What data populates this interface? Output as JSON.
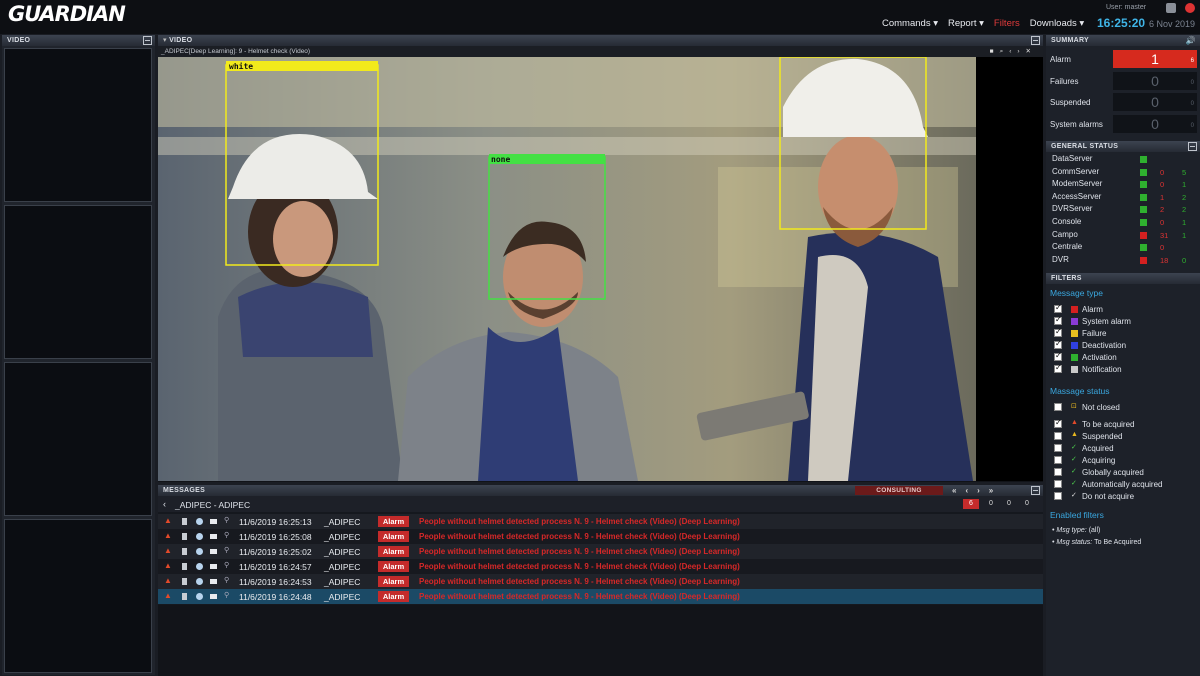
{
  "app": {
    "logo": "GUARDIAN",
    "user": "User: master",
    "clock": "16:25:20",
    "date": "6 Nov 2019"
  },
  "nav": [
    "Commands ▾",
    "Report ▾",
    "Filters",
    "Downloads ▾"
  ],
  "left_panel": {
    "title": "VIDEO"
  },
  "video_panel": {
    "title": "VIDEO",
    "caption": "_ADIPEC[Deep Learning]: 9 - Helmet check (Video)",
    "detections": [
      {
        "label": "white",
        "color": "#f2ea1c"
      },
      {
        "label": "none",
        "color": "#44e044"
      },
      {
        "label": "",
        "color": "#f2ea1c"
      }
    ]
  },
  "messages": {
    "title": "MESSAGES",
    "mode": "CONSULTING",
    "group": "_ADIPEC - ADIPEC",
    "counters": [
      "6",
      "0",
      "0",
      "0"
    ],
    "rows": [
      {
        "time": "11/6/2019 16:25:13",
        "source": "_ADIPEC",
        "type": "Alarm",
        "text": "People without helmet detected process N. 9 - Helmet check (Video) (Deep Learning)"
      },
      {
        "time": "11/6/2019 16:25:08",
        "source": "_ADIPEC",
        "type": "Alarm",
        "text": "People without helmet detected process N. 9 - Helmet check (Video) (Deep Learning)"
      },
      {
        "time": "11/6/2019 16:25:02",
        "source": "_ADIPEC",
        "type": "Alarm",
        "text": "People without helmet detected process N. 9 - Helmet check (Video) (Deep Learning)"
      },
      {
        "time": "11/6/2019 16:24:57",
        "source": "_ADIPEC",
        "type": "Alarm",
        "text": "People without helmet detected process N. 9 - Helmet check (Video) (Deep Learning)"
      },
      {
        "time": "11/6/2019 16:24:53",
        "source": "_ADIPEC",
        "type": "Alarm",
        "text": "People without helmet detected process N. 9 - Helmet check (Video) (Deep Learning)"
      },
      {
        "time": "11/6/2019 16:24:48",
        "source": "_ADIPEC",
        "type": "Alarm",
        "text": "People without helmet detected process N. 9 - Helmet check (Video) (Deep Learning)"
      }
    ]
  },
  "summary": {
    "title": "SUMMARY",
    "rows": [
      {
        "label": "Alarm",
        "value": "1",
        "small": "6",
        "highlight": true
      },
      {
        "label": "Failures",
        "value": "0",
        "small": "0",
        "highlight": false
      },
      {
        "label": "Suspended",
        "value": "0",
        "small": "0",
        "highlight": false
      },
      {
        "label": "System alarms",
        "value": "0",
        "small": "0",
        "highlight": false
      }
    ]
  },
  "general_status": {
    "title": "GENERAL STATUS",
    "rows": [
      {
        "name": "DataServer",
        "color": "#2fb02f",
        "a": "",
        "b": ""
      },
      {
        "name": "CommServer",
        "color": "#2fb02f",
        "a": "0",
        "b": "5"
      },
      {
        "name": "ModemServer",
        "color": "#2fb02f",
        "a": "0",
        "b": "1"
      },
      {
        "name": "AccessServer",
        "color": "#2fb02f",
        "a": "1",
        "b": "2"
      },
      {
        "name": "DVRServer",
        "color": "#2fb02f",
        "a": "2",
        "b": "2"
      },
      {
        "name": "Console",
        "color": "#2fb02f",
        "a": "0",
        "b": "1"
      },
      {
        "name": "Campo",
        "color": "#d32020",
        "a": "31",
        "b": "1"
      },
      {
        "name": "Centrale",
        "color": "#2fb02f",
        "a": "0",
        "b": ""
      },
      {
        "name": "DVR",
        "color": "#d32020",
        "a": "18",
        "b": "0"
      }
    ]
  },
  "filters": {
    "title": "FILTERS",
    "message_type_title": "Message type",
    "message_types": [
      {
        "label": "Alarm",
        "color": "#d42020",
        "checked": true
      },
      {
        "label": "System alarm",
        "color": "#8a3bd6",
        "checked": true
      },
      {
        "label": "Failure",
        "color": "#e8c020",
        "checked": true
      },
      {
        "label": "Deactivation",
        "color": "#3040e0",
        "checked": true
      },
      {
        "label": "Activation",
        "color": "#2fb02f",
        "checked": true
      },
      {
        "label": "Notification",
        "color": "#c8c8c8",
        "checked": true
      }
    ],
    "message_status_title": "Massage status",
    "statuses": [
      {
        "label": "Not closed",
        "icon": "🔒",
        "checked": false
      },
      {
        "label": "To be acquired",
        "icon": "▲",
        "checked": true
      },
      {
        "label": "Suspended",
        "icon": "▲",
        "checked": false
      },
      {
        "label": "Acquired",
        "icon": "✓",
        "checked": false
      },
      {
        "label": "Acquiring",
        "icon": "✓",
        "checked": false
      },
      {
        "label": "Globally acquired",
        "icon": "✓",
        "checked": false
      },
      {
        "label": "Automatically acquired",
        "icon": "✓",
        "checked": false
      },
      {
        "label": "Do not acquire",
        "icon": "✓",
        "checked": false
      }
    ],
    "enabled_title": "Enabled filters",
    "enabled": [
      {
        "key": "Msg type:",
        "value": "(all)"
      },
      {
        "key": "Msg status:",
        "value": "To Be Acquired"
      }
    ]
  }
}
